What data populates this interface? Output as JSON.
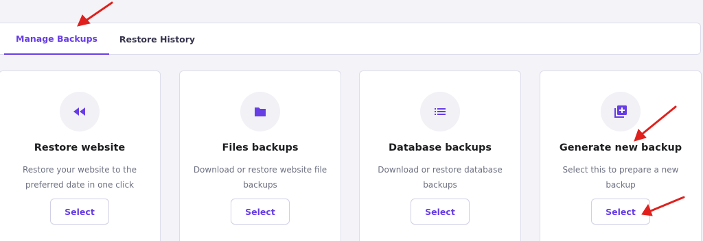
{
  "tabs": {
    "manage_backups": "Manage Backups",
    "restore_history": "Restore History"
  },
  "cards": [
    {
      "icon": "rewind-icon",
      "title": "Restore website",
      "desc_line1": "Restore your website to the",
      "desc_line2": "preferred date in one click",
      "button": "Select"
    },
    {
      "icon": "folder-icon",
      "title": "Files backups",
      "desc_line1": "Download or restore website file",
      "desc_line2": "backups",
      "button": "Select"
    },
    {
      "icon": "list-icon",
      "title": "Database backups",
      "desc_line1": "Download or restore database",
      "desc_line2": "backups",
      "button": "Select"
    },
    {
      "icon": "add-library-icon",
      "title": "Generate new backup",
      "desc_line1": "Select this to prepare a new",
      "desc_line2": "backup",
      "button": "Select"
    }
  ],
  "colors": {
    "accent": "#673de6",
    "annotation_arrow": "#e0201c",
    "background": "#f3f3f8"
  }
}
